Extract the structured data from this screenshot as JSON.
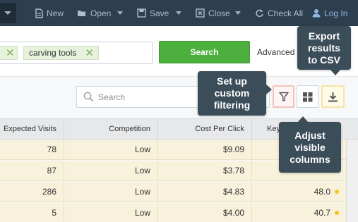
{
  "toolbar": {
    "items": [
      {
        "label": "New",
        "icon": "new-document-icon"
      },
      {
        "label": "Open",
        "icon": "folder-icon"
      },
      {
        "label": "Save",
        "icon": "floppy-disk-icon"
      },
      {
        "label": "Close",
        "icon": "close-box-icon"
      },
      {
        "label": "Check All",
        "icon": "refresh-icon"
      },
      {
        "label": "Log In",
        "icon": "user-icon"
      }
    ]
  },
  "keywords": {
    "chips": [
      "carving tools"
    ]
  },
  "search_button": {
    "label": "Search"
  },
  "advanced": {
    "label": "Advanced"
  },
  "filter": {
    "placeholder": "Search"
  },
  "tooltips": {
    "filter": "Set up\ncustom\nfiltering",
    "columns": "Adjust\nvisible\ncolumns",
    "export": "Export\nresults\nto CSV"
  },
  "table": {
    "columns": [
      "Expected Visits",
      "Competition",
      "Cost Per Click",
      "Key"
    ],
    "rows": [
      {
        "visits": "78",
        "competition": "Low",
        "cpc": "$9.09",
        "score": ""
      },
      {
        "visits": "87",
        "competition": "Low",
        "cpc": "$3.78",
        "score": ""
      },
      {
        "visits": "286",
        "competition": "Low",
        "cpc": "$4.83",
        "score": "48.0"
      },
      {
        "visits": "5",
        "competition": "Low",
        "cpc": "$4.00",
        "score": "40.7"
      }
    ]
  },
  "colors": {
    "toolbar_bg": "#2d3f4e",
    "search_green": "#4caf3e",
    "row_bg": "#f8f1dc",
    "score_dot": "#f5c518",
    "tooltip_bg": "#3c4d5a"
  }
}
